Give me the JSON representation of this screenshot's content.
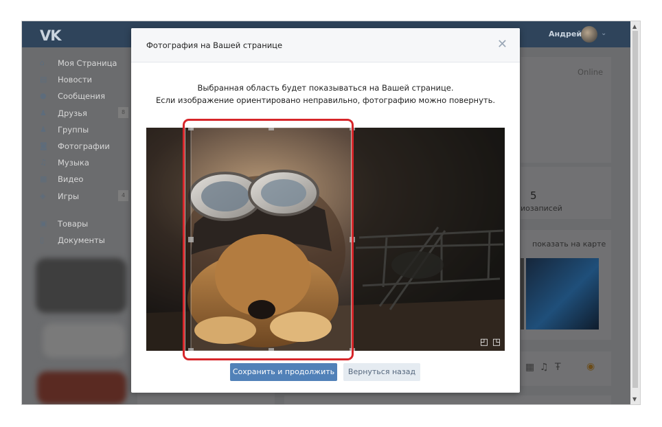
{
  "header": {
    "logo": "VK",
    "user_name": "Андрей"
  },
  "sidebar": {
    "items": [
      {
        "label": "Моя Страница",
        "icon": "home-icon",
        "glyph": "⌂"
      },
      {
        "label": "Новости",
        "icon": "news-icon",
        "glyph": "▤"
      },
      {
        "label": "Сообщения",
        "icon": "messages-icon",
        "glyph": "●"
      },
      {
        "label": "Друзья",
        "icon": "friends-icon",
        "glyph": "♟",
        "badge": "8"
      },
      {
        "label": "Группы",
        "icon": "groups-icon",
        "glyph": "♟"
      },
      {
        "label": "Фотографии",
        "icon": "photos-icon",
        "glyph": "◙"
      },
      {
        "label": "Музыка",
        "icon": "music-icon",
        "glyph": "♫"
      },
      {
        "label": "Видео",
        "icon": "video-icon",
        "glyph": "▦"
      },
      {
        "label": "Игры",
        "icon": "games-icon",
        "glyph": "◈",
        "badge": "4"
      }
    ],
    "extra_items": [
      {
        "label": "Товары",
        "icon": "goods-icon",
        "glyph": "▣"
      },
      {
        "label": "Документы",
        "icon": "documents-icon",
        "glyph": "▯"
      }
    ]
  },
  "profile": {
    "status": "Online",
    "count_value": "5",
    "count_label": "иозаписей",
    "map_link": "показать на карте"
  },
  "modal": {
    "title": "Фотография на Вашей странице",
    "line1": "Выбранная область будет показываться на Вашей странице.",
    "line2": "Если изображение ориентировано неправильно, фотографию можно повернуть.",
    "save_label": "Сохранить и продолжить",
    "back_label": "Вернуться назад"
  },
  "colors": {
    "header": "#2f445b",
    "primary_button": "#5181b8",
    "secondary_button": "#e5ebf1",
    "highlight": "#d7262a"
  }
}
